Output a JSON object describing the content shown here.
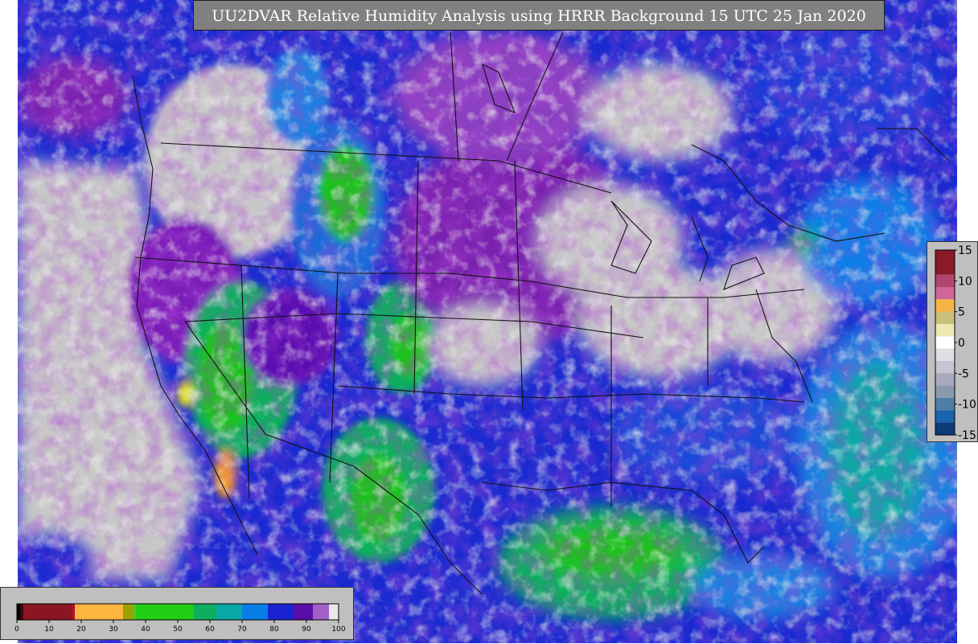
{
  "title": "UU2DVAR Relative Humidity Analysis using HRRR Background 15 UTC 25 Jan 2020",
  "rh_legend": {
    "ticks": [
      "0",
      "10",
      "20",
      "30",
      "40",
      "50",
      "60",
      "70",
      "80",
      "90",
      "100"
    ],
    "bins": [
      {
        "from": 0,
        "to": 1,
        "color": "#000000"
      },
      {
        "from": 1,
        "to": 2,
        "color": "#3a0a0a"
      },
      {
        "from": 2,
        "to": 17,
        "color": "#8b1520"
      },
      {
        "from": 17,
        "to": 18,
        "color": "#b0102a"
      },
      {
        "from": 18,
        "to": 33,
        "color": "#fcb540"
      },
      {
        "from": 33,
        "to": 36,
        "color": "#99a300"
      },
      {
        "from": 36,
        "to": 37,
        "color": "#5cc02a"
      },
      {
        "from": 37,
        "to": 55,
        "color": "#22cc12"
      },
      {
        "from": 55,
        "to": 62,
        "color": "#0fae5e"
      },
      {
        "from": 62,
        "to": 70,
        "color": "#07a8a6"
      },
      {
        "from": 70,
        "to": 78,
        "color": "#0a7ee8"
      },
      {
        "from": 78,
        "to": 86,
        "color": "#1b22d0"
      },
      {
        "from": 86,
        "to": 92,
        "color": "#5a0ea8"
      },
      {
        "from": 92,
        "to": 97,
        "color": "#a060c8"
      },
      {
        "from": 97,
        "to": 100,
        "color": "#e8e8e8"
      }
    ]
  },
  "anomaly_legend": {
    "ticks": [
      "15",
      "10",
      "5",
      "0",
      "-5",
      "-10",
      "-15"
    ],
    "bins": [
      {
        "from": 15,
        "to": 11,
        "color": "#8b1a28"
      },
      {
        "from": 11,
        "to": 9,
        "color": "#b0456e"
      },
      {
        "from": 9,
        "to": 7,
        "color": "#d0659a"
      },
      {
        "from": 7,
        "to": 5,
        "color": "#f7b446"
      },
      {
        "from": 5,
        "to": 3,
        "color": "#c9c07a"
      },
      {
        "from": 3,
        "to": 1,
        "color": "#ebe9b0"
      },
      {
        "from": 1,
        "to": -1,
        "color": "#ffffff"
      },
      {
        "from": -1,
        "to": -3,
        "color": "#dedee4"
      },
      {
        "from": -3,
        "to": -5,
        "color": "#c8c4d4"
      },
      {
        "from": -5,
        "to": -7,
        "color": "#a8a9bd"
      },
      {
        "from": -7,
        "to": -9,
        "color": "#8a9aae"
      },
      {
        "from": -9,
        "to": -11,
        "color": "#4f7ea8"
      },
      {
        "from": -11,
        "to": -13,
        "color": "#1a63ae"
      },
      {
        "from": -13,
        "to": -15,
        "color": "#0d3a78"
      }
    ]
  },
  "map_colors": {
    "land_dry": "#c8c8c8",
    "humid_purple": "#6a10a8",
    "humid_blue": "#1a2ad0",
    "moist_cyan": "#0f8ce0",
    "moist_green": "#1fc21f",
    "dry_yellow": "#e6e21c",
    "dry_orange": "#f09a30",
    "ocean_blue": "#1a80e0",
    "borders": "#111111"
  }
}
